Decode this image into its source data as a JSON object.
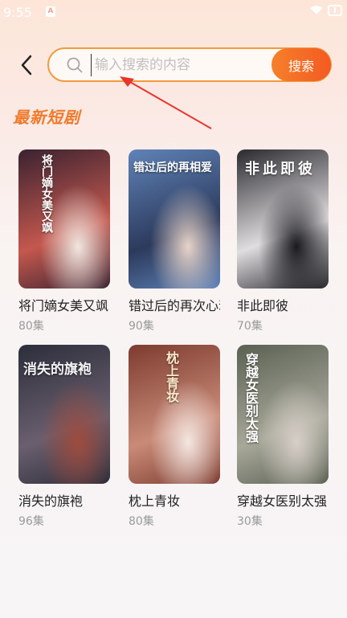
{
  "status": {
    "time": "9:55",
    "notice": "A"
  },
  "search": {
    "placeholder": "输入搜索的内容",
    "button_label": "搜索"
  },
  "section": {
    "title": "最新短剧"
  },
  "dramas": [
    {
      "title": "将门嫡女美又飒",
      "episodes": "80集",
      "poster_text": "将门嫡女美又飒",
      "colors": [
        "#3a2230",
        "#c4584e",
        "#efe6e0"
      ]
    },
    {
      "title": "错过后的再次心动",
      "episodes": "90集",
      "poster_text": "错过后的再相爱",
      "colors": [
        "#5f83b8",
        "#2c3a5c",
        "#e7d3c8"
      ]
    },
    {
      "title": "非此即彼",
      "episodes": "70集",
      "poster_text": "非此即彼",
      "colors": [
        "#2a2a2e",
        "#e0dde0",
        "#1b1b1f"
      ]
    },
    {
      "title": "消失的旗袍",
      "episodes": "96集",
      "poster_text": "消失的旗袍",
      "colors": [
        "#2c2e3b",
        "#6a5f6e",
        "#9e4b3e"
      ]
    },
    {
      "title": "枕上青妆",
      "episodes": "80集",
      "poster_text": "枕上青妆",
      "colors": [
        "#7d3b2f",
        "#c98b78",
        "#f4e7e2"
      ]
    },
    {
      "title": "穿越女医别太强",
      "episodes": "30集",
      "poster_text": "穿越女医别太强",
      "colors": [
        "#5a6152",
        "#a8a89a",
        "#d7cfc9"
      ]
    }
  ]
}
